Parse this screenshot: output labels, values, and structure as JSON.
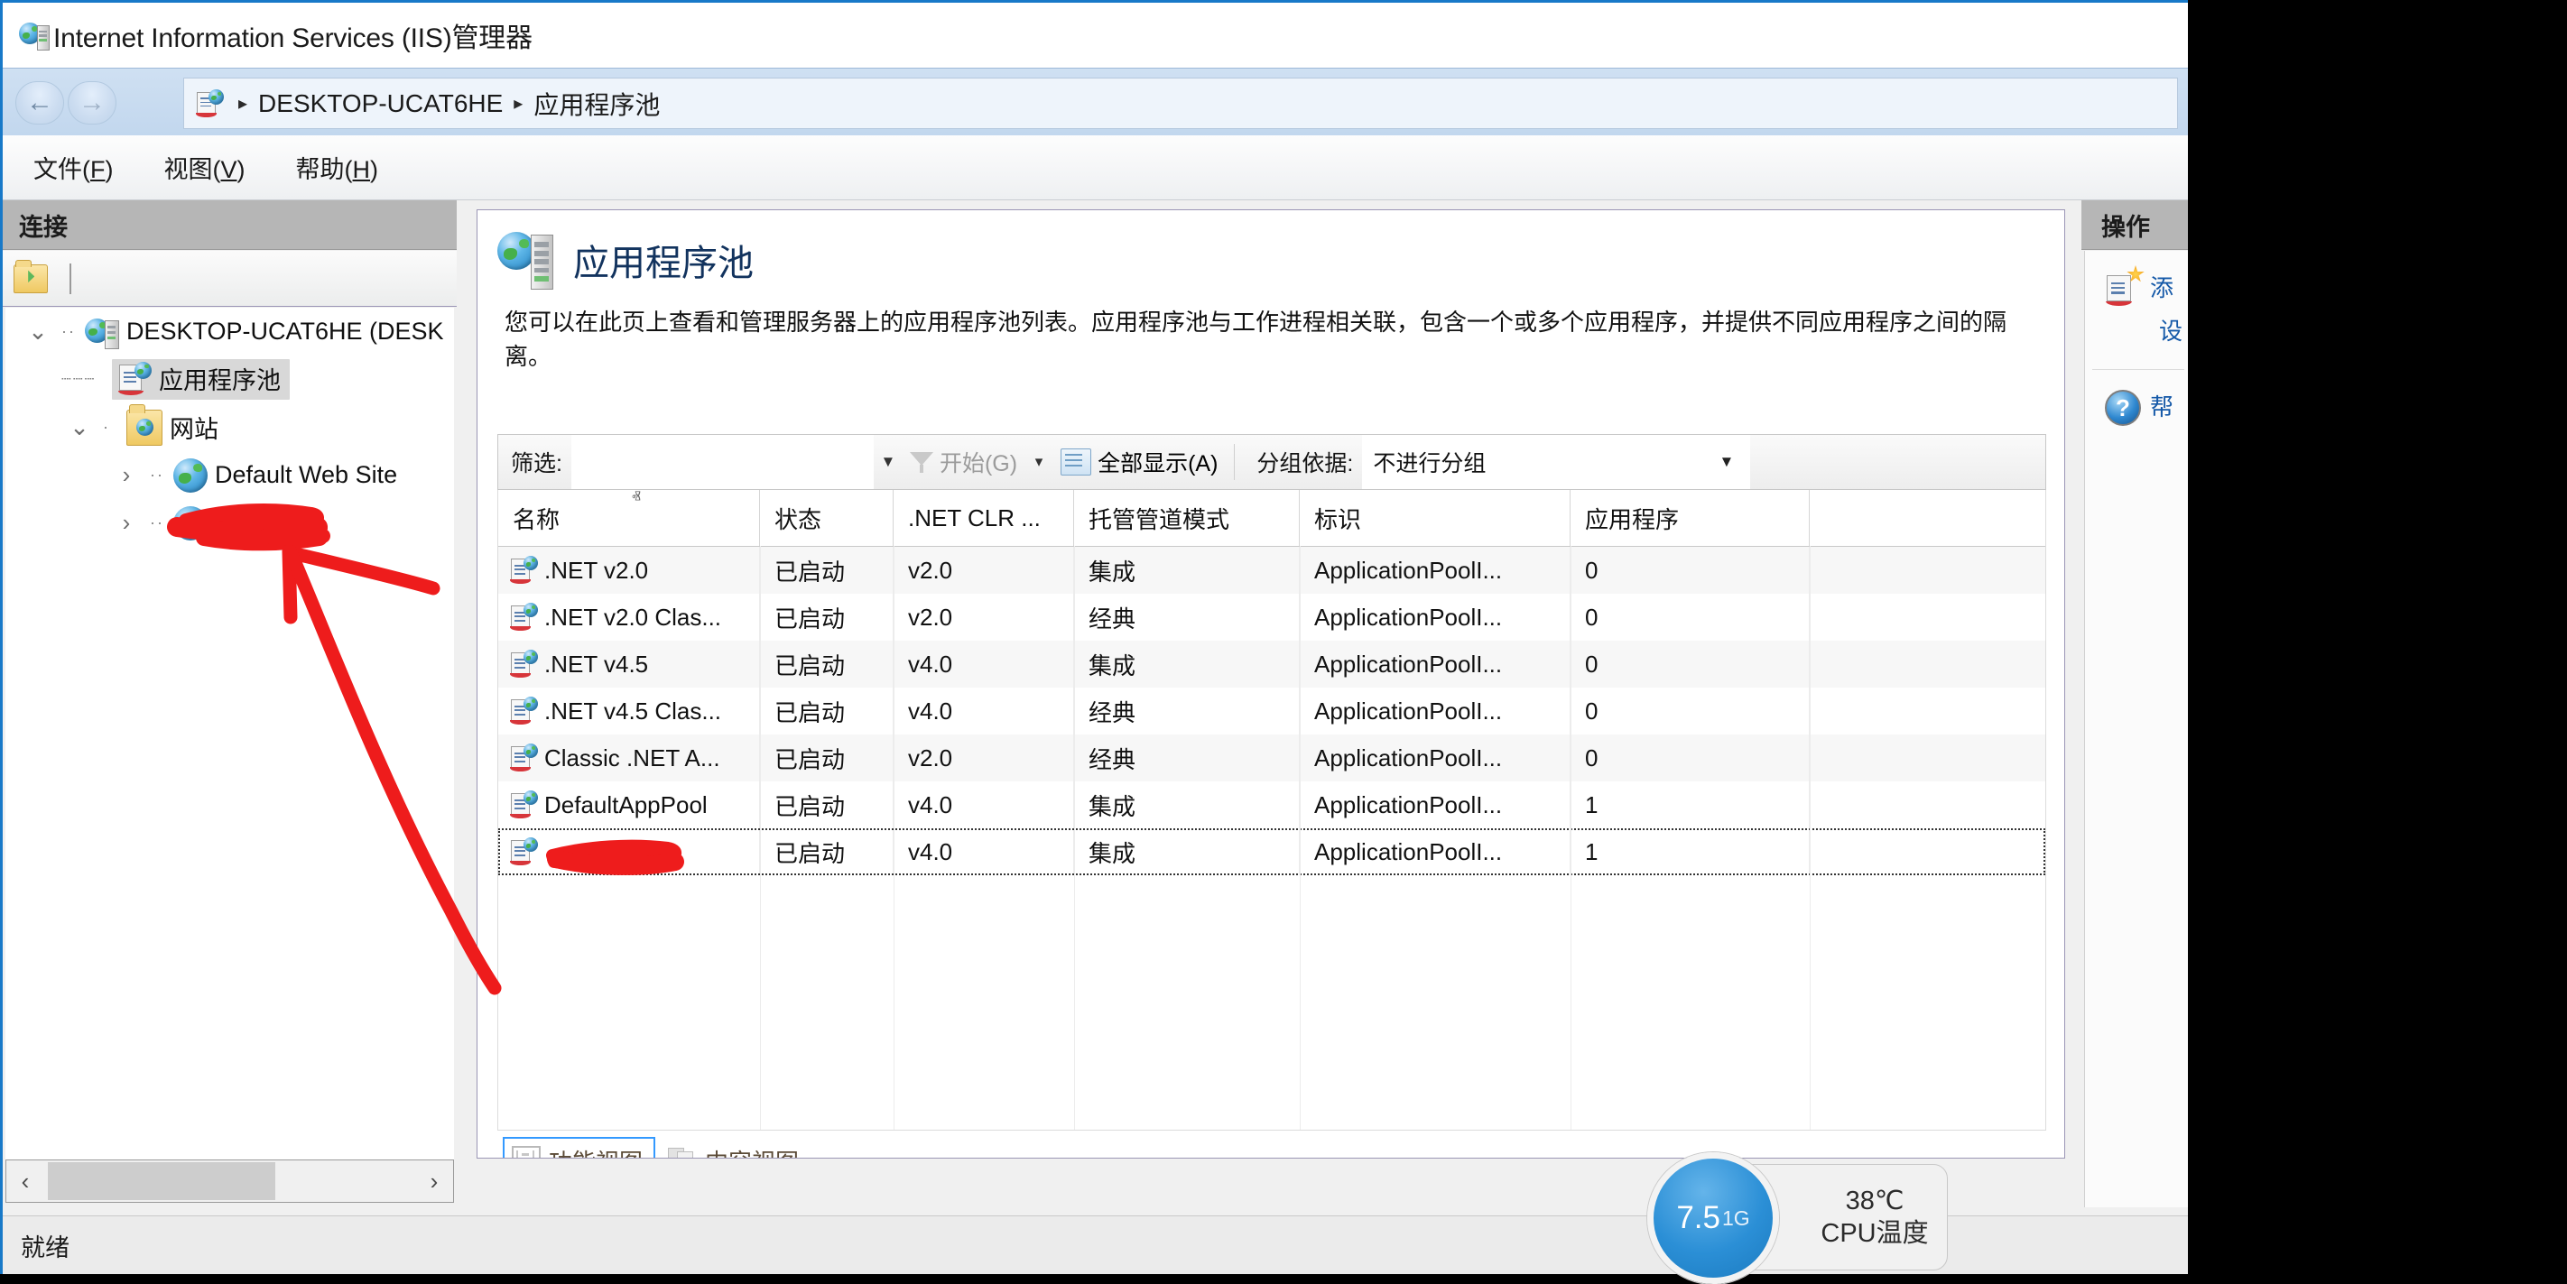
{
  "window": {
    "title": "Internet Information Services (IIS)管理器",
    "title_icon": "iis-server-icon"
  },
  "breadcrumb": {
    "icon": "app-pool-icon",
    "separator": "▸",
    "items": [
      "DESKTOP-UCAT6HE",
      "应用程序池"
    ],
    "back_glyph": "←",
    "forward_glyph": "→"
  },
  "menubar": {
    "items": [
      {
        "label": "文件",
        "accel": "F"
      },
      {
        "label": "视图",
        "accel": "V"
      },
      {
        "label": "帮助",
        "accel": "H"
      }
    ]
  },
  "connections": {
    "header": "连接",
    "toolbar_icon": "connect-folder-icon",
    "tree": [
      {
        "indent": 0,
        "twisty": "⌄",
        "icon": "server-icon",
        "label": "DESKTOP-UCAT6HE (DESK",
        "selected": false
      },
      {
        "indent": 1,
        "twisty": "",
        "icon": "app-pool-icon",
        "label": "应用程序池",
        "selected": true
      },
      {
        "indent": 1,
        "twisty": "⌄",
        "icon": "sites-folder-icon",
        "label": "网站",
        "selected": false
      },
      {
        "indent": 2,
        "twisty": "›",
        "icon": "site-globe-icon",
        "label": "Default Web Site",
        "selected": false
      },
      {
        "indent": 2,
        "twisty": "›",
        "icon": "site-globe-icon",
        "label": "",
        "selected": false,
        "redacted": true
      }
    ],
    "hscroll": {
      "left_arrow": "‹",
      "right_arrow": "›"
    }
  },
  "page": {
    "icon": "app-pool-large-icon",
    "title": "应用程序池",
    "description": "您可以在此页上查看和管理服务器上的应用程序池列表。应用程序池与工作进程相关联，包含一个或多个应用程序，并提供不同应用程序之间的隔离。"
  },
  "filterbar": {
    "filter_label": "筛选:",
    "filter_value": "",
    "filter_placeholder": "",
    "dropdown_caret": "▼",
    "go_label": "开始(G)",
    "go_accel": "G",
    "go_icon": "funnel-icon",
    "go_caret": "▾",
    "showall_label": "全部显示(A)",
    "showall_accel": "A",
    "showall_icon": "show-all-icon",
    "groupby_label": "分组依据:",
    "groupby_value": "不进行分组",
    "groupby_caret": "▼"
  },
  "table": {
    "sort_indicator": "ⱏ",
    "columns": [
      "名称",
      "状态",
      ".NET CLR ...",
      "托管管道模式",
      "标识",
      "应用程序"
    ],
    "rows": [
      {
        "icon": "app-pool-icon",
        "name": ".NET v2.0",
        "state": "已启动",
        "clr": "v2.0",
        "pipeline": "集成",
        "identity": "ApplicationPoolI...",
        "apps": "0",
        "selected": false
      },
      {
        "icon": "app-pool-icon",
        "name": ".NET v2.0 Clas...",
        "state": "已启动",
        "clr": "v2.0",
        "pipeline": "经典",
        "identity": "ApplicationPoolI...",
        "apps": "0",
        "selected": false
      },
      {
        "icon": "app-pool-icon",
        "name": ".NET v4.5",
        "state": "已启动",
        "clr": "v4.0",
        "pipeline": "集成",
        "identity": "ApplicationPoolI...",
        "apps": "0",
        "selected": false
      },
      {
        "icon": "app-pool-icon",
        "name": ".NET v4.5 Clas...",
        "state": "已启动",
        "clr": "v4.0",
        "pipeline": "经典",
        "identity": "ApplicationPoolI...",
        "apps": "0",
        "selected": false
      },
      {
        "icon": "app-pool-icon",
        "name": "Classic .NET A...",
        "state": "已启动",
        "clr": "v2.0",
        "pipeline": "经典",
        "identity": "ApplicationPoolI...",
        "apps": "0",
        "selected": false
      },
      {
        "icon": "app-pool-icon",
        "name": "DefaultAppPool",
        "state": "已启动",
        "clr": "v4.0",
        "pipeline": "集成",
        "identity": "ApplicationPoolI...",
        "apps": "1",
        "selected": false
      },
      {
        "icon": "app-pool-icon",
        "name": "",
        "state": "已启动",
        "clr": "v4.0",
        "pipeline": "集成",
        "identity": "ApplicationPoolI...",
        "apps": "1",
        "selected": true,
        "redacted": true
      }
    ]
  },
  "viewtabs": [
    {
      "label": "功能视图",
      "icon": "features-view-icon",
      "active": true
    },
    {
      "label": "内容视图",
      "icon": "content-view-icon",
      "active": false
    }
  ],
  "actions": {
    "header": "操作",
    "items": [
      {
        "icon": "add-app-pool-icon",
        "lines": [
          "添",
          "设"
        ]
      },
      {
        "icon": "help-icon",
        "lines": [
          "帮"
        ]
      }
    ]
  },
  "statusbar": {
    "text": "就绪"
  },
  "cpu_widget": {
    "memory_value": "7.5",
    "memory_unit": "1G",
    "temperature": "38℃",
    "temperature_label": "CPU温度"
  },
  "colors": {
    "accent": "#1879c8",
    "annotation": "#ee1c1c",
    "link": "#1559a8",
    "title_blue": "#12335e",
    "pane_header": "#b6b6b6"
  }
}
